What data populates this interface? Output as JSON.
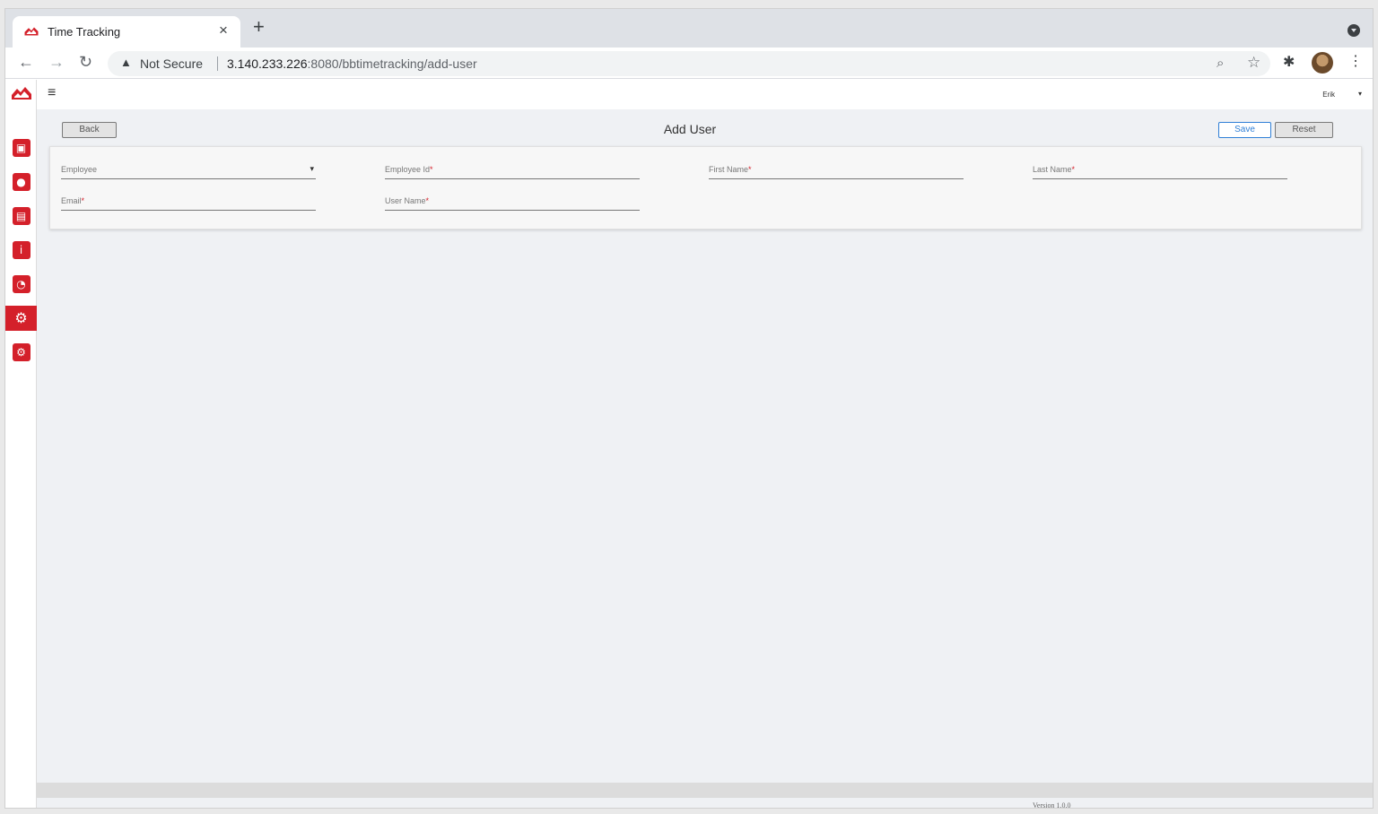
{
  "browser": {
    "tab_title": "Time Tracking",
    "tab_close": "×",
    "new_tab": "+",
    "warning_icon": "▲",
    "security_label": "Not Secure",
    "url_host": "3.140.233.226",
    "url_rest": ":8080/bbtimetracking/add-user",
    "zoom_icon": "⌕",
    "star_icon": "☆",
    "extensions_icon": "✱",
    "menu_icon": "⋮"
  },
  "nav": {
    "back": "←",
    "forward": "→",
    "reload": "↻"
  },
  "app": {
    "hamburger": "≡",
    "user_name": "Erik",
    "user_caret": "▾",
    "page_title": "Add User",
    "back_label": "Back",
    "save_label": "Save",
    "reset_label": "Reset",
    "version": "Version 1.0.0"
  },
  "sidebar": {
    "items": [
      {
        "icon": "dashboard-icon",
        "glyph": "▣"
      },
      {
        "icon": "person-icon",
        "glyph": "●"
      },
      {
        "icon": "document-icon",
        "glyph": "▤"
      },
      {
        "icon": "info-icon",
        "glyph": "i"
      },
      {
        "icon": "user-clock-icon",
        "glyph": "◔"
      },
      {
        "icon": "gear-icon",
        "glyph": "⚙"
      },
      {
        "icon": "user-settings-icon",
        "glyph": "⚙"
      }
    ],
    "active_index": 5
  },
  "form": {
    "employee": "Employee",
    "employee_id": "Employee Id",
    "first_name": "First Name",
    "last_name": "Last Name",
    "email": "Email",
    "user_name": "User Name",
    "required_mark": "*",
    "dropdown_caret": "▾"
  },
  "colors": {
    "brand_red": "#d4202a",
    "save_blue": "#2f7fd6"
  }
}
